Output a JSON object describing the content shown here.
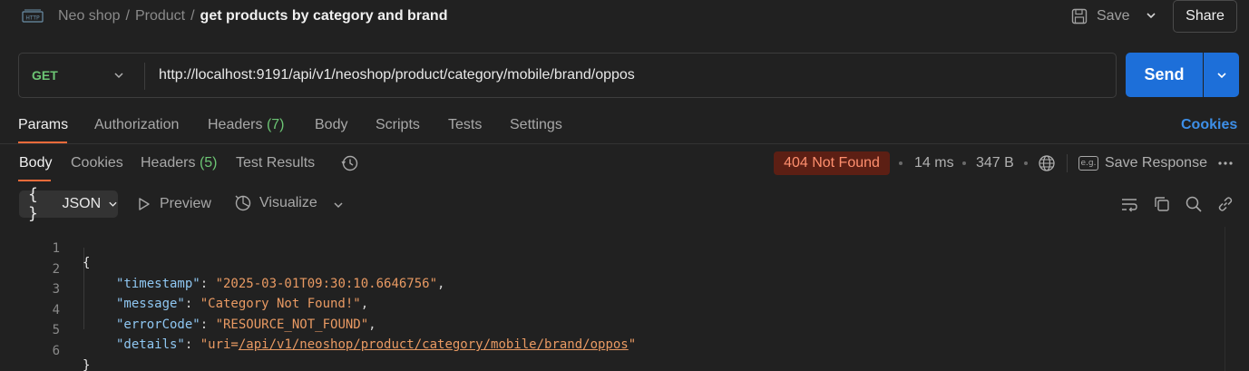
{
  "header": {
    "breadcrumbs": [
      "Neo shop",
      "Product"
    ],
    "separator": "/",
    "current_title": "get products by category and brand",
    "save_label": "Save",
    "share_label": "Share"
  },
  "request": {
    "method": "GET",
    "url": "http://localhost:9191/api/v1/neoshop/product/category/mobile/brand/oppos",
    "send_label": "Send"
  },
  "request_tabs": {
    "items": [
      {
        "label": "Params",
        "count": ""
      },
      {
        "label": "Authorization",
        "count": ""
      },
      {
        "label": "Headers",
        "count": "(7)"
      },
      {
        "label": "Body",
        "count": ""
      },
      {
        "label": "Scripts",
        "count": ""
      },
      {
        "label": "Tests",
        "count": ""
      },
      {
        "label": "Settings",
        "count": ""
      }
    ],
    "active": "Params",
    "cookies_label": "Cookies"
  },
  "response_tabs": {
    "items": [
      {
        "label": "Body",
        "count": ""
      },
      {
        "label": "Cookies",
        "count": ""
      },
      {
        "label": "Headers",
        "count": "(5)"
      },
      {
        "label": "Test Results",
        "count": ""
      }
    ],
    "active": "Body"
  },
  "response_meta": {
    "status": "404 Not Found",
    "time": "14 ms",
    "size": "347 B",
    "save_response_label": "Save Response",
    "eg_label": "e.g."
  },
  "format_bar": {
    "format": "JSON",
    "preview_label": "Preview",
    "visualize_label": "Visualize"
  },
  "response_body": {
    "line_numbers": [
      "1",
      "2",
      "3",
      "4",
      "5",
      "6"
    ],
    "open_brace": "{",
    "close_brace": "}",
    "fields": [
      {
        "key": "\"timestamp\"",
        "value": "\"2025-03-01T09:30:10.6646756\"",
        "comma": ","
      },
      {
        "key": "\"message\"",
        "value": "\"Category Not Found!\"",
        "comma": ","
      },
      {
        "key": "\"errorCode\"",
        "value": "\"RESOURCE_NOT_FOUND\"",
        "comma": ","
      }
    ],
    "details": {
      "key": "\"details\"",
      "prefix": "\"uri=",
      "link": "/api/v1/neoshop/product/category/mobile/brand/oppos",
      "suffix": "\""
    }
  },
  "colors": {
    "accent_orange": "#f26b3a",
    "send_blue": "#1d6fd9",
    "method_green": "#6cc574",
    "status_bg": "#5c1f14",
    "status_text": "#ff8f6e",
    "json_key": "#8fc7f2",
    "json_string": "#e99a63"
  },
  "icons": [
    "http-icon",
    "save-icon",
    "chevron-down-icon",
    "history-icon",
    "globe-icon",
    "eg-icon",
    "more-icon",
    "play-icon",
    "visualize-icon",
    "wrap-icon",
    "copy-icon",
    "search-icon",
    "link-icon"
  ]
}
